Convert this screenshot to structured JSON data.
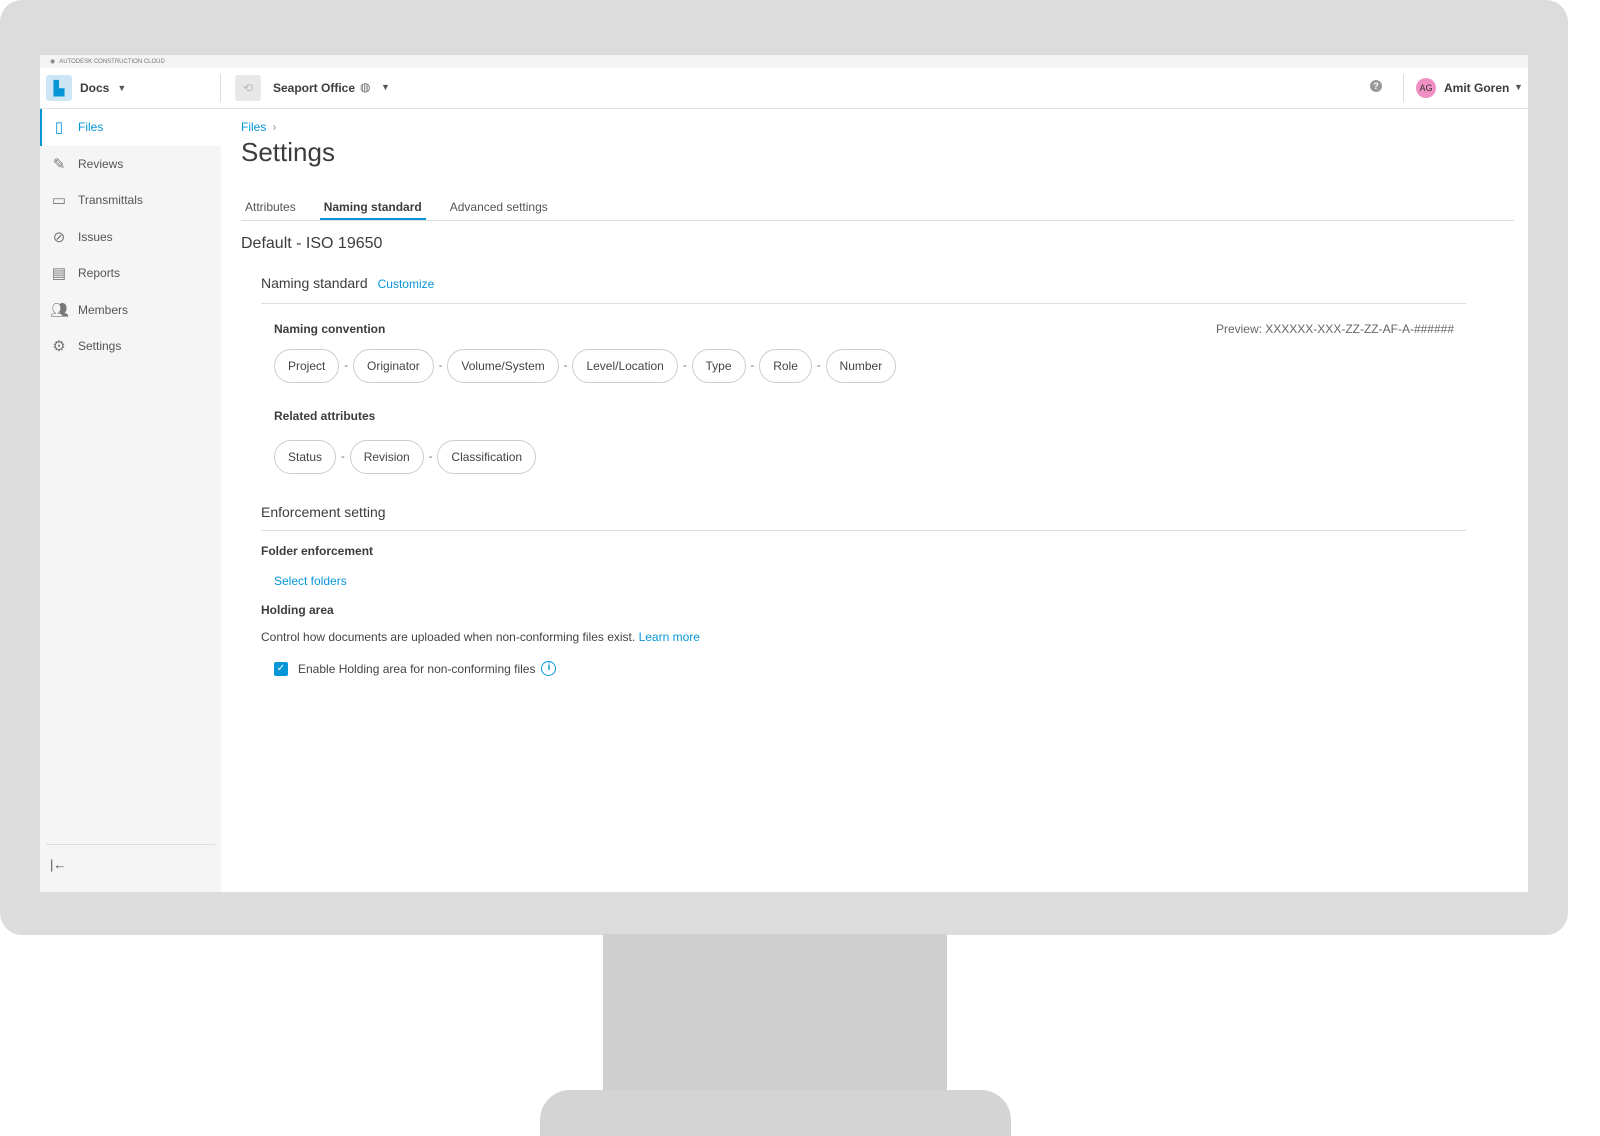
{
  "brand": "AUTODESK CONSTRUCTION CLOUD",
  "header": {
    "app": "Docs",
    "project": "Seaport Office",
    "user_initials": "AG",
    "user_name": "Amit Goren"
  },
  "sidebar": {
    "items": [
      {
        "label": "Files"
      },
      {
        "label": "Reviews"
      },
      {
        "label": "Transmittals"
      },
      {
        "label": "Issues"
      },
      {
        "label": "Reports"
      },
      {
        "label": "Members"
      },
      {
        "label": "Settings"
      }
    ],
    "collapse": "|←"
  },
  "breadcrumb": "Files",
  "title": "Settings",
  "tabs": [
    "Attributes",
    "Naming standard",
    "Advanced settings"
  ],
  "standard_title": "Default - ISO 19650",
  "naming": {
    "heading": "Naming standard",
    "customize": "Customize",
    "convention_label": "Naming convention",
    "preview": "Preview: XXXXXX-XXX-ZZ-ZZ-AF-A-######",
    "parts": [
      "Project",
      "Originator",
      "Volume/System",
      "Level/Location",
      "Type",
      "Role",
      "Number"
    ],
    "related_label": "Related attributes",
    "related": [
      "Status",
      "Revision",
      "Classification"
    ],
    "separator": "-"
  },
  "enforcement": {
    "heading": "Enforcement setting",
    "folder_label": "Folder enforcement",
    "select_folders": "Select folders",
    "holding_label": "Holding area",
    "holding_desc": "Control how documents are uploaded when non-conforming files exist.",
    "learn_more": "Learn more",
    "checkbox_label": "Enable Holding area for non-conforming files",
    "checked": true
  },
  "colors": {
    "accent": "#0696d7",
    "avatar": "#f08fc4"
  }
}
